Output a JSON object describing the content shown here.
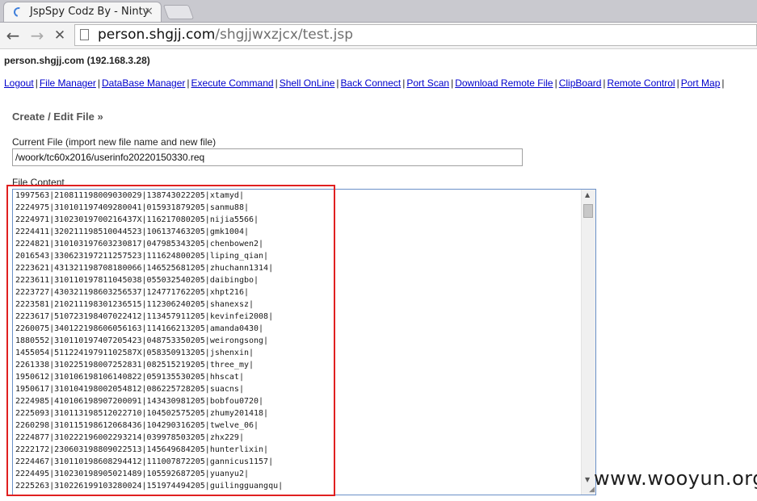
{
  "browser": {
    "tab_title": "JspSpy Codz By - Ninty",
    "tab_close_icon": "×",
    "url_host": "person.shgjj.com",
    "url_path": "/shgjjwxzjcx/test.jsp",
    "back_icon": "←",
    "forward_icon": "→",
    "stop_icon": "✕"
  },
  "page": {
    "host_line": "person.shgjj.com (192.168.3.28)",
    "menu": [
      "Logout",
      "File Manager",
      "DataBase Manager",
      "Execute Command",
      "Shell OnLine",
      "Back Connect",
      "Port Scan",
      "Download Remote File",
      "ClipBoard",
      "Remote Control",
      "Port Map"
    ],
    "menu_separator": "|",
    "section_title": "Create / Edit File »",
    "current_file_label": "Current File (import new file name and new file)",
    "current_file_value": "/woork/tc60x2016/userinfo20220150330.req",
    "file_content_label": "File Content",
    "file_lines": [
      "1997563|210811198009030029|138743022205|xtamyd|",
      "2224975|310101197409280041|015931879205|sanmu88|",
      "2224971|31023019700216437X|116217080205|nijia5566|",
      "2224411|320211198510044523|106137463205|gmk1004|",
      "2224821|310103197603230817|047985343205|chenbowen2|",
      "2016543|330623197211257523|111624800205|liping_qian|",
      "2223621|431321198708180066|146525681205|zhuchann1314|",
      "2223611|310110197811045038|055032540205|daibingbo|",
      "2223727|430321198603256537|124771762205|xhpt216|",
      "2223581|210211198301236515|112306240205|shanexsz|",
      "2223617|510723198407022412|113457911205|kevinfei2008|",
      "2260075|340122198606056163|114166213205|amanda0430|",
      "1880552|310110197407205423|048753350205|weirongsong|",
      "1455054|51122419791102587X|058350913205|jshenxin|",
      "2261338|310225198007252831|082515219205|three_my|",
      "1950612|310106198106140822|059135530205|hhscat|",
      "1950617|310104198002054812|086225728205|suacns|",
      "2224985|410106198907200091|143430981205|bobfou0720|",
      "2225093|310113198512022710|104502575205|zhumy201418|",
      "2260298|310115198612068436|104290316205|twelve_06|",
      "2224877|310222196002293214|039978503205|zhx229|",
      "2222172|230603198809022513|145649684205|hunterlixin|",
      "2224467|310110198608294412|111007872205|gannicus1157|",
      "2224495|310230198905021489|105592687205|yuanyu2|",
      "2225263|310226199103280024|151974494205|guilingguangqu|"
    ]
  },
  "watermark": "www.wooyun.org",
  "colors": {
    "link": "#0000cc",
    "highlight_border": "#e02020",
    "textarea_border": "#6a90c8"
  }
}
